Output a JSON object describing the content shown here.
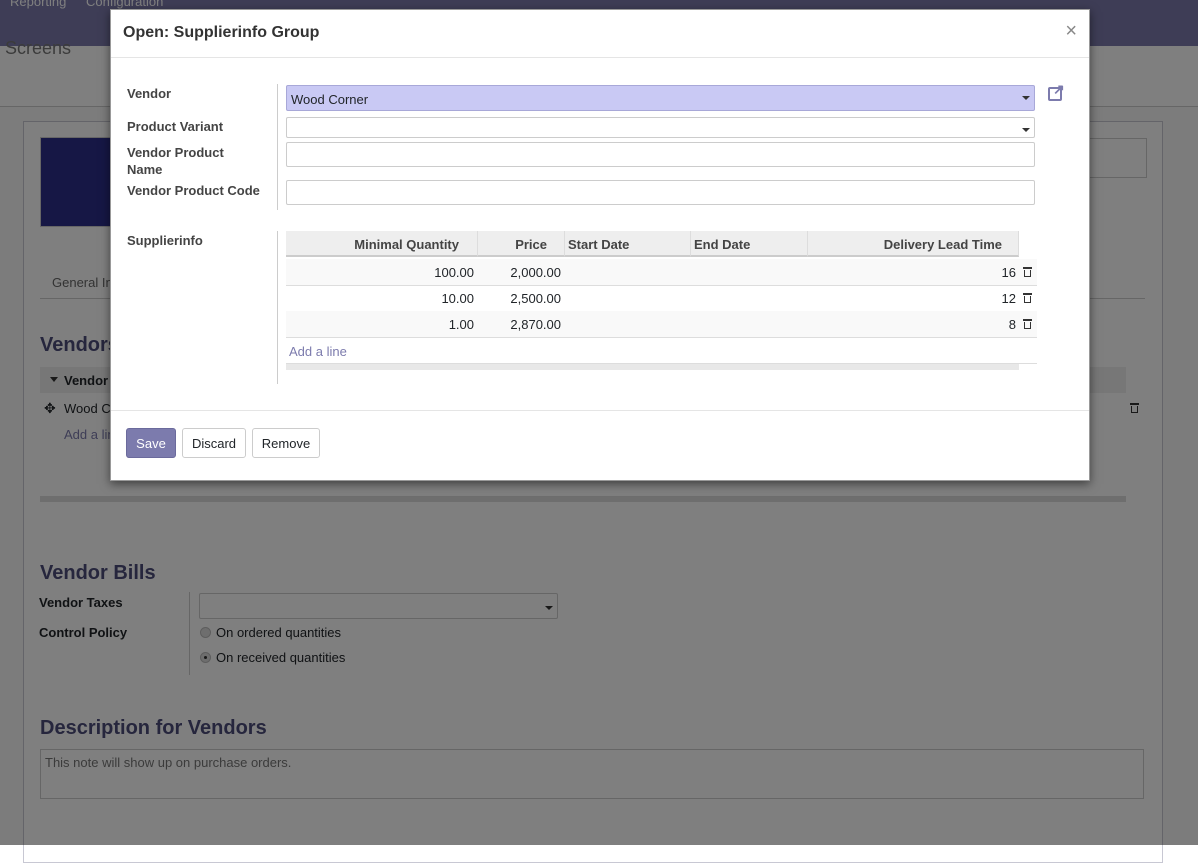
{
  "topnav": {
    "items": [
      "Reporting",
      "Configuration"
    ]
  },
  "breadcrumb": {
    "text": "Screens"
  },
  "background": {
    "tab_general": "General In",
    "vendors_title": "Vendors",
    "vendor_col": "Vendor",
    "vendor_row": "Wood C",
    "add_line": "Add a lin",
    "vendor_bills_title": "Vendor Bills",
    "vendor_taxes_label": "Vendor Taxes",
    "control_policy_label": "Control Policy",
    "policy_options": [
      "On ordered quantities",
      "On received quantities"
    ],
    "policy_selected": "On received quantities",
    "description_title": "Description for Vendors",
    "description_placeholder": "This note will show up on purchase orders."
  },
  "dialog": {
    "title": "Open: Supplierinfo Group",
    "close": "×",
    "fields": {
      "vendor_label": "Vendor",
      "vendor_value": "Wood Corner",
      "variant_label": "Product Variant",
      "variant_value": "",
      "product_name_label_1": "Vendor Product",
      "product_name_label_2": "Name",
      "product_name_value": "",
      "product_code_label": "Vendor Product Code",
      "product_code_value": ""
    },
    "supplierinfo": {
      "label": "Supplierinfo",
      "columns": [
        "Minimal Quantity",
        "Price",
        "Start Date",
        "End Date",
        "Delivery Lead Time"
      ],
      "rows": [
        {
          "min_qty": "100.00",
          "price": "2,000.00",
          "start": "",
          "end": "",
          "lead": "16"
        },
        {
          "min_qty": "10.00",
          "price": "2,500.00",
          "start": "",
          "end": "",
          "lead": "12"
        },
        {
          "min_qty": "1.00",
          "price": "2,870.00",
          "start": "",
          "end": "",
          "lead": "8"
        }
      ],
      "add_line": "Add a line"
    },
    "buttons": {
      "save": "Save",
      "discard": "Discard",
      "remove": "Remove"
    }
  }
}
